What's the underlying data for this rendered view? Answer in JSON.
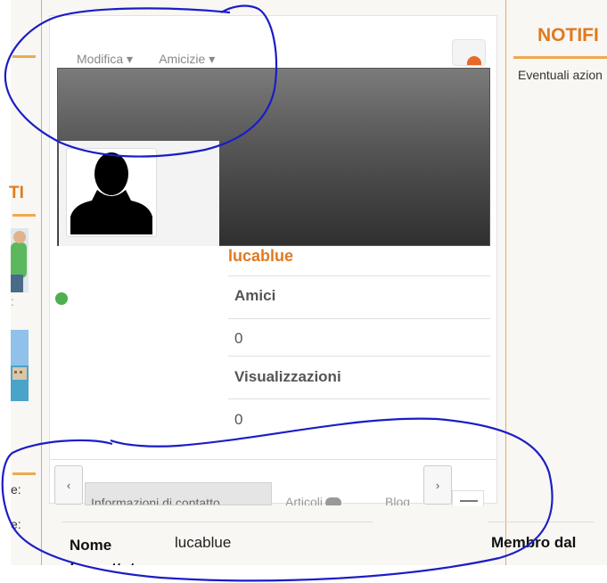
{
  "profile_tabs": {
    "edit": "Modifica ▾",
    "friends": "Amicizie ▾"
  },
  "left_sidebar": {
    "heading": "TI",
    "label_1": "e:",
    "label_2": "e:"
  },
  "profile": {
    "username": "lucablue",
    "stats": [
      {
        "label": "Amici",
        "value": "0"
      },
      {
        "label": "Visualizzazioni",
        "value": "0"
      }
    ]
  },
  "tabs": {
    "prev": "‹",
    "next": "›",
    "items": [
      "Informazioni di contatto",
      "Articoli",
      "Blog"
    ]
  },
  "details": {
    "name_label": "Nome formattato",
    "name_value": "lucablue",
    "member_since_label": "Membro dal"
  },
  "notifications": {
    "title": "NOTIFI",
    "text": "Eventuali azion"
  },
  "colors": {
    "accent": "#e07a1f",
    "online": "#4caf50",
    "annotation": "#1c1cc8"
  }
}
